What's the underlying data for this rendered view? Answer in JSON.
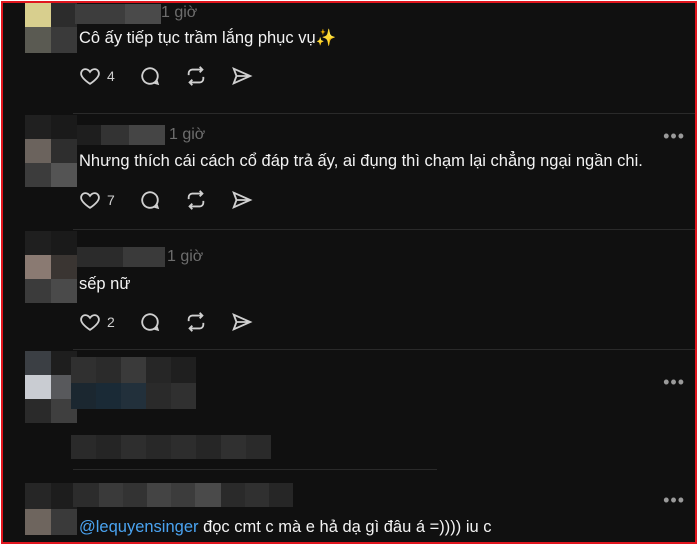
{
  "posts": [
    {
      "time": "1 giờ",
      "text": "Cô ấy tiếp tục trầm lắng phục vụ✨",
      "likes": "4"
    },
    {
      "time": "1 giờ",
      "text": "Nhưng thích cái cách cổ đáp trả ấy, ai đụng thì chạm lại chẳng ngại ngần chi.",
      "likes": "7"
    },
    {
      "time": "1 giờ",
      "text": "sếp nữ",
      "likes": "2"
    },
    {
      "time": "",
      "text": "",
      "likes": ""
    },
    {
      "time": "",
      "mention": "@lequyensinger",
      "text": " đọc cmt c mà e hả dạ gì đâu á =)))) iu c",
      "likes": ""
    }
  ],
  "icons": {
    "like": "heart-icon",
    "comment": "comment-icon",
    "repost": "repost-icon",
    "share": "send-icon",
    "more": "more-options-icon"
  },
  "colors": {
    "background": "#101010",
    "text": "#f3f3f3",
    "muted": "#6d6d6d",
    "mention": "#4aa3f0",
    "border": "#e0161e"
  }
}
